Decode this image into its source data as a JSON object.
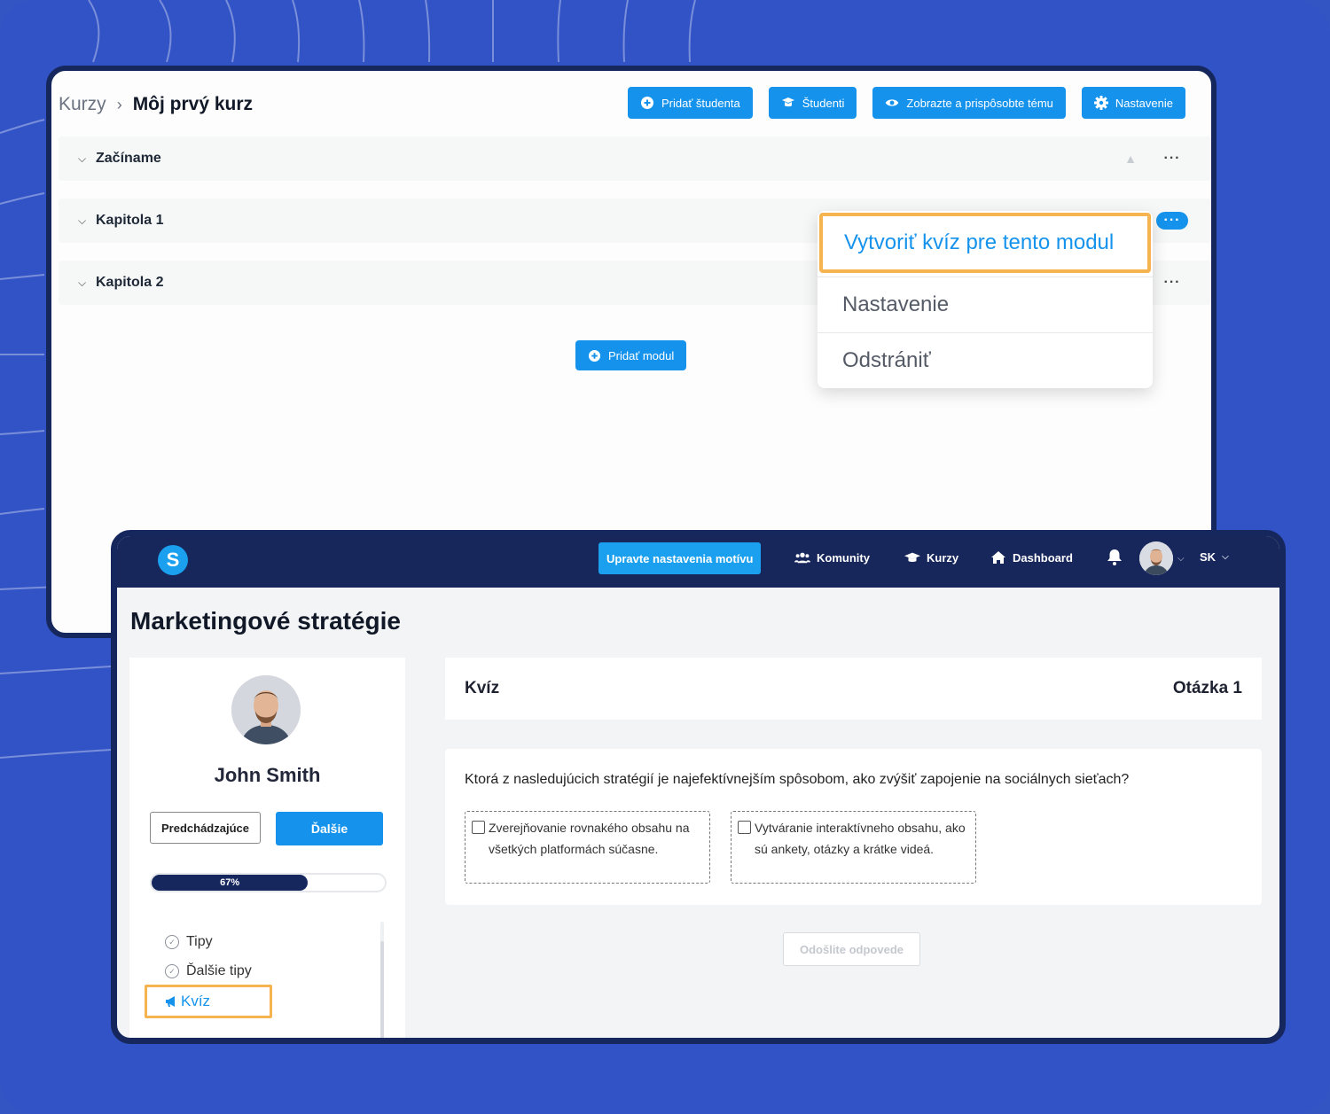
{
  "colors": {
    "background": "#3253c6",
    "accent": "#1593ec",
    "navy": "#16275e",
    "highlight": "#f6b451"
  },
  "editor": {
    "breadcrumb": {
      "root": "Kurzy",
      "current": "Môj prvý kurz"
    },
    "toolbar": {
      "add_student": "Pridať študenta",
      "students": "Študenti",
      "theme": "Zobrazte a prispôsobte tému",
      "settings": "Nastavenie"
    },
    "sections": [
      {
        "title": "Začíname"
      },
      {
        "title": "Kapitola 1"
      },
      {
        "title": "Kapitola 2"
      }
    ],
    "add_module": "Pridať modul",
    "dropdown": {
      "create_quiz": "Vytvoriť kvíz pre tento modul",
      "settings": "Nastavenie",
      "delete": "Odstrániť"
    }
  },
  "learner": {
    "logo_letter": "S",
    "nav": {
      "cta": "Upravte nastavenia motívu",
      "communities": "Komunity",
      "courses": "Kurzy",
      "dashboard": "Dashboard",
      "language": "SK"
    },
    "page_title": "Marketingové stratégie",
    "sidebar": {
      "user_name": "John Smith",
      "prev": "Predchádzajúce",
      "next": "Ďalšie",
      "progress_label": "67%",
      "progress_value": 0.67,
      "lessons": [
        "Tipy",
        "Ďalšie tipy"
      ],
      "active_lesson": "Kvíz"
    },
    "quiz": {
      "title": "Kvíz",
      "question_label": "Otázka 1",
      "question": "Ktorá z nasledujúcich stratégií je najefektívnejším spôsobom, ako zvýšiť zapojenie na sociálnych sieťach?",
      "answers": [
        "Zverejňovanie rovnakého obsahu na všetkých platformách súčasne.",
        "Vytváranie interaktívneho obsahu, ako sú ankety, otázky a krátke videá."
      ],
      "submit": "Odošlite odpovede"
    }
  }
}
